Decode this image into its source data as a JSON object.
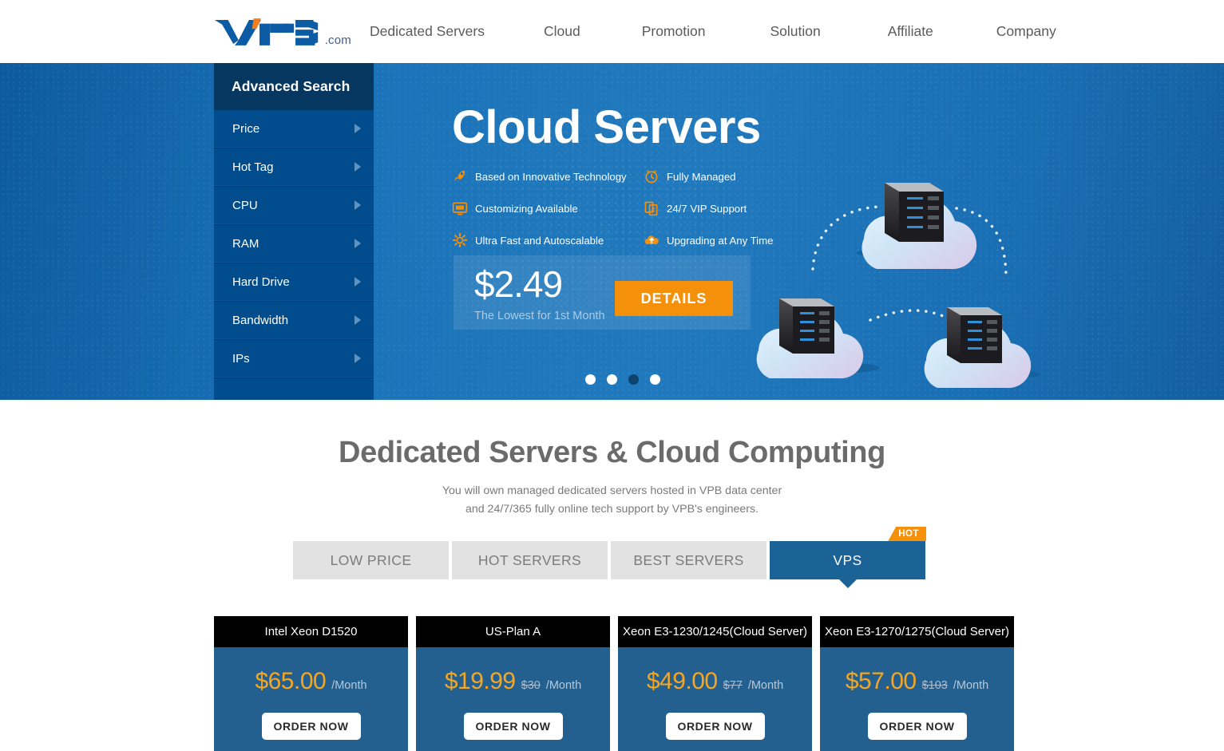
{
  "header": {
    "logo_text": "VPB",
    "logo_suffix": ".com",
    "nav": [
      {
        "label": "Dedicated Servers"
      },
      {
        "label": "Cloud"
      },
      {
        "label": "Promotion"
      },
      {
        "label": "Solution"
      },
      {
        "label": "Affiliate"
      },
      {
        "label": "Company"
      }
    ]
  },
  "sidebar": {
    "title": "Advanced Search",
    "items": [
      {
        "label": "Price"
      },
      {
        "label": "Hot Tag"
      },
      {
        "label": "CPU"
      },
      {
        "label": "RAM"
      },
      {
        "label": "Hard Drive"
      },
      {
        "label": "Bandwidth"
      },
      {
        "label": "IPs"
      }
    ]
  },
  "hero": {
    "title": "Cloud Servers",
    "features": [
      {
        "label": "Based on Innovative Technology",
        "icon": "rocket-icon"
      },
      {
        "label": "Fully Managed",
        "icon": "clock-icon"
      },
      {
        "label": "Customizing Available",
        "icon": "monitor-icon"
      },
      {
        "label": "24/7 VIP Support",
        "icon": "documents-icon"
      },
      {
        "label": "Ultra Fast and Autoscalable",
        "icon": "gear-icon"
      },
      {
        "label": "Upgrading at Any Time",
        "icon": "cloud-upload-icon"
      }
    ],
    "price": "$2.49",
    "price_caption": "The Lowest for 1st Month",
    "details_label": "DETAILS",
    "carousel": {
      "total": 4,
      "active_index": 2
    }
  },
  "section": {
    "title": "Dedicated Servers & Cloud Computing",
    "paragraph_line1": "You will own managed dedicated servers hosted in VPB data center",
    "paragraph_line2": "and 24/7/365 fully online tech support by VPB's engineers.",
    "tabs": [
      {
        "label": "LOW PRICE",
        "active": false,
        "badge": ""
      },
      {
        "label": "HOT SERVERS",
        "active": false,
        "badge": ""
      },
      {
        "label": "BEST SERVERS",
        "active": false,
        "badge": ""
      },
      {
        "label": "VPS",
        "active": true,
        "badge": "HOT"
      }
    ],
    "cards": [
      {
        "name": "Intel Xeon D1520",
        "price": "$65.00",
        "old_price": "",
        "per": "/Month",
        "cta": "ORDER NOW"
      },
      {
        "name": "US-Plan A",
        "price": "$19.99",
        "old_price": "$30",
        "per": "/Month",
        "cta": "ORDER NOW"
      },
      {
        "name": "Xeon E3-1230/1245(Cloud Server)",
        "price": "$49.00",
        "old_price": "$77",
        "per": "/Month",
        "cta": "ORDER NOW"
      },
      {
        "name": "Xeon E3-1270/1275(Cloud Server)",
        "price": "$57.00",
        "old_price": "$103",
        "per": "/Month",
        "cta": "ORDER NOW"
      }
    ]
  },
  "colors": {
    "brand_blue": "#0b5ca5",
    "hero_blue": "#1d74ba",
    "sidebar_blue": "#004c8c",
    "accent_orange": "#f5900b",
    "card_blue": "#23608f",
    "tab_active": "#1b6297"
  }
}
